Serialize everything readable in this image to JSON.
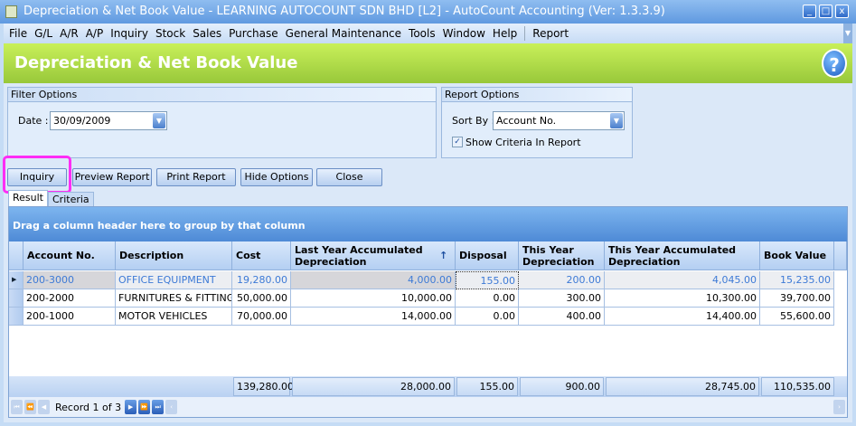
{
  "window": {
    "title": "Depreciation & Net Book Value - LEARNING AUTOCOUNT SDN BHD [L2] - AutoCount Accounting (Ver: 1.3.3.9)"
  },
  "menu": [
    "File",
    "G/L",
    "A/R",
    "A/P",
    "Inquiry",
    "Stock",
    "Sales",
    "Purchase",
    "General Maintenance",
    "Tools",
    "Window",
    "Help"
  ],
  "menu_extra": "Report",
  "header": {
    "title": "Depreciation & Net Book Value",
    "help": "?"
  },
  "filter": {
    "title": "Filter Options",
    "date_label": "Date :",
    "date_value": "30/09/2009"
  },
  "report_options": {
    "title": "Report Options",
    "sort_label": "Sort By :",
    "sort_value": "Account No.",
    "show_criteria_label": "Show Criteria In Report",
    "show_criteria_checked": true
  },
  "buttons": {
    "inquiry": "Inquiry",
    "preview": "Preview Report",
    "print": "Print Report",
    "hide": "Hide Options",
    "close": "Close"
  },
  "tabs": {
    "result": "Result",
    "criteria": "Criteria"
  },
  "grid": {
    "group_hint": "Drag a column header here to group by that column",
    "columns": [
      "Account No.",
      "Description",
      "Cost",
      "Last Year Accumulated Depreciation",
      "Disposal",
      "This Year Depreciation",
      "This Year Accumulated Depreciation",
      "Book Value"
    ],
    "rows": [
      [
        "200-3000",
        "OFFICE EQUIPMENT",
        "19,280.00",
        "4,000.00",
        "155.00",
        "200.00",
        "4,045.00",
        "15,235.00"
      ],
      [
        "200-2000",
        "FURNITURES & FITTINGS",
        "50,000.00",
        "10,000.00",
        "0.00",
        "300.00",
        "10,300.00",
        "39,700.00"
      ],
      [
        "200-1000",
        "MOTOR VEHICLES",
        "70,000.00",
        "14,000.00",
        "0.00",
        "400.00",
        "14,400.00",
        "55,600.00"
      ]
    ],
    "totals": [
      "139,280.00",
      "28,000.00",
      "155.00",
      "900.00",
      "28,745.00",
      "110,535.00"
    ],
    "record_text": "Record 1 of 3"
  },
  "colors": {
    "accent_green": "#98c83a",
    "selected_text": "#3d7ad6",
    "highlight": "#ff2df5"
  }
}
